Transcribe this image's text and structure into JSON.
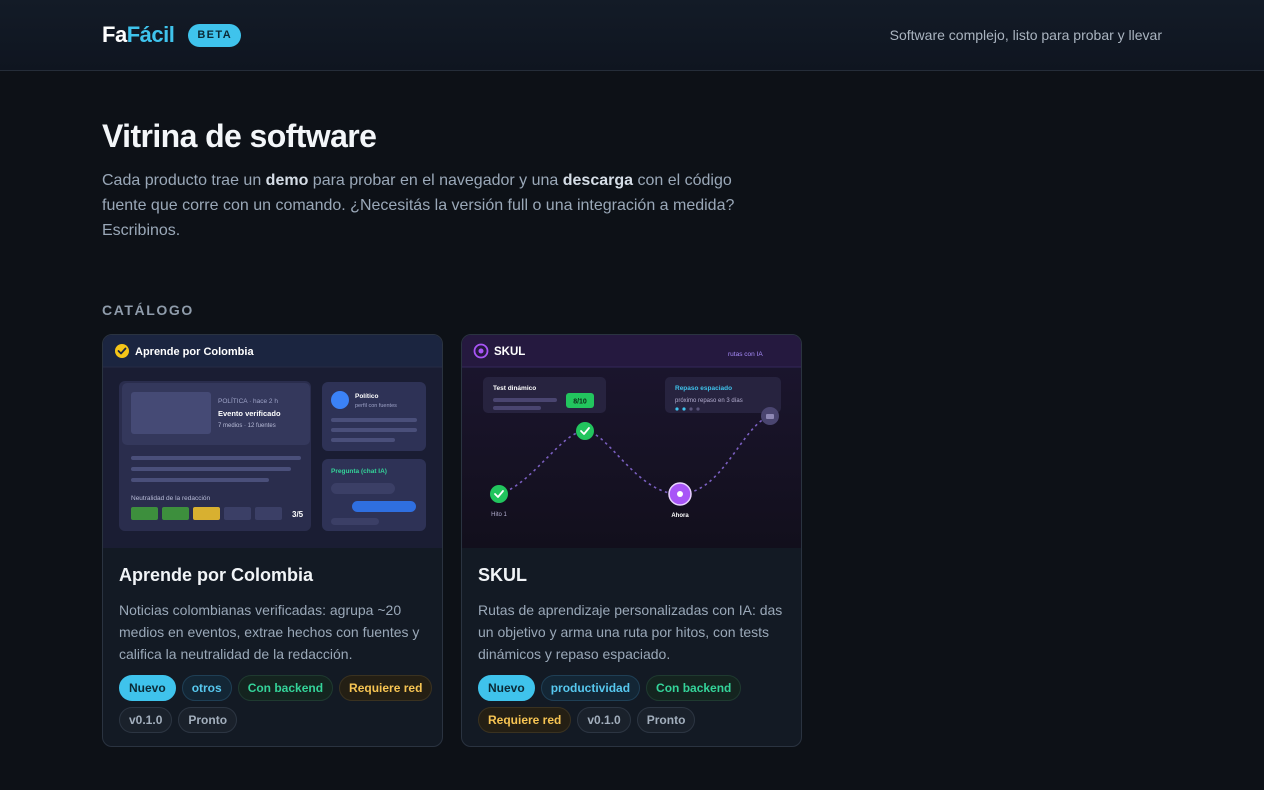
{
  "header": {
    "brand_part1": "Fa",
    "brand_part2": "Fácil",
    "badge": "BETA",
    "tagline": "Software complejo, listo para probar y llevar"
  },
  "hero": {
    "title": "Vitrina de software",
    "desc_1": "Cada producto trae un ",
    "desc_demo": "demo",
    "desc_2": " para probar en el navegador y una ",
    "desc_descarga": "descarga",
    "desc_3": " con el código fuente que corre con un comando. ¿Necesitás la versión full o una integración a medida? Escribinos."
  },
  "catalog": {
    "label": "CATÁLOGO",
    "cards": [
      {
        "title": "Aprende por Colombia",
        "description": "Noticias colombianas verificadas: agrupa ~20 medios en eventos, extrae hechos con fuentes y califica la neutralidad de la redacción.",
        "preview": {
          "header": "Aprende por Colombia",
          "meta": "POLÍTICA · hace 2 h",
          "event_title": "Evento verificado",
          "event_sub": "7 medios · 12 fuentes",
          "neutrality_label": "Neutralidad de la redacción",
          "neutrality_score": "3/5",
          "profile_name": "Político",
          "profile_sub": "perfil con fuentes",
          "chat_label": "Pregunta (chat IA)"
        },
        "tags": {
          "new": "Nuevo",
          "category": "otros",
          "backend": "Con backend",
          "network": "Requiere red",
          "version": "v0.1.0",
          "status": "Pronto"
        }
      },
      {
        "title": "SKUL",
        "description": "Rutas de aprendizaje personalizadas con IA: das un objetivo y arma una ruta por hitos, con tests dinámicos y repaso espaciado.",
        "preview": {
          "header": "SKUL",
          "header_right": "rutas con IA",
          "test_title": "Test dinámico",
          "test_score": "8/10",
          "review_title": "Repaso espaciado",
          "review_sub": "próximo repaso en 3 días",
          "milestone_1": "Hito 1",
          "milestone_now": "Ahora"
        },
        "tags": {
          "new": "Nuevo",
          "category": "productividad",
          "backend": "Con backend",
          "network": "Requiere red",
          "version": "v0.1.0",
          "status": "Pronto"
        }
      }
    ]
  },
  "colors": {
    "background": "#0d1117",
    "accent": "#3fc3ec",
    "success": "#22c55e",
    "purple": "#a855f7",
    "warning": "#f6c453"
  }
}
